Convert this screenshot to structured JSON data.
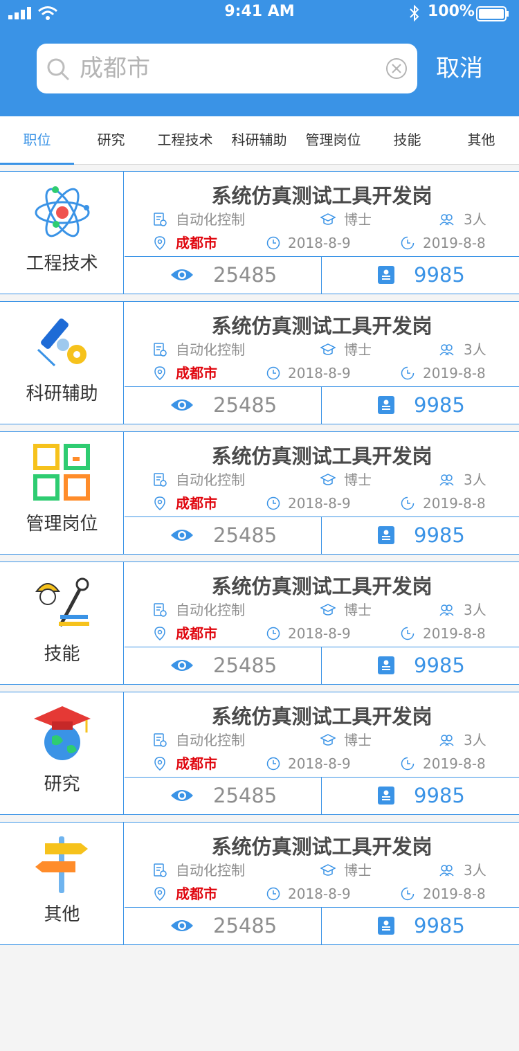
{
  "status_bar": {
    "time": "9:41 AM",
    "battery": "100%"
  },
  "search": {
    "query": "成都市",
    "cancel_label": "取消"
  },
  "tabs": [
    {
      "label": "职位",
      "active": true
    },
    {
      "label": "研究",
      "active": false
    },
    {
      "label": "工程技术",
      "active": false
    },
    {
      "label": "科研辅助",
      "active": false
    },
    {
      "label": "管理岗位",
      "active": false
    },
    {
      "label": "技能",
      "active": false
    },
    {
      "label": "其他",
      "active": false
    }
  ],
  "colors": {
    "primary": "#3a93e6",
    "location": "#e0070f"
  },
  "jobs": [
    {
      "category": "工程技术",
      "category_icon": "atom-icon",
      "title": "系统仿真测试工具开发岗",
      "specialty": "自动化控制",
      "degree": "博士",
      "headcount": "3人",
      "location": "成都市",
      "start_date": "2018-8-9",
      "end_date": "2019-8-8",
      "views": "25485",
      "applicants": "9985"
    },
    {
      "category": "科研辅助",
      "category_icon": "microscope-gear-icon",
      "title": "系统仿真测试工具开发岗",
      "specialty": "自动化控制",
      "degree": "博士",
      "headcount": "3人",
      "location": "成都市",
      "start_date": "2018-8-9",
      "end_date": "2019-8-8",
      "views": "25485",
      "applicants": "9985"
    },
    {
      "category": "管理岗位",
      "category_icon": "grid-blocks-icon",
      "title": "系统仿真测试工具开发岗",
      "specialty": "自动化控制",
      "degree": "博士",
      "headcount": "3人",
      "location": "成都市",
      "start_date": "2018-8-9",
      "end_date": "2019-8-8",
      "views": "25485",
      "applicants": "9985"
    },
    {
      "category": "技能",
      "category_icon": "worker-tools-icon",
      "title": "系统仿真测试工具开发岗",
      "specialty": "自动化控制",
      "degree": "博士",
      "headcount": "3人",
      "location": "成都市",
      "start_date": "2018-8-9",
      "end_date": "2019-8-8",
      "views": "25485",
      "applicants": "9985"
    },
    {
      "category": "研究",
      "category_icon": "graduation-globe-icon",
      "title": "系统仿真测试工具开发岗",
      "specialty": "自动化控制",
      "degree": "博士",
      "headcount": "3人",
      "location": "成都市",
      "start_date": "2018-8-9",
      "end_date": "2019-8-8",
      "views": "25485",
      "applicants": "9985"
    },
    {
      "category": "其他",
      "category_icon": "signpost-icon",
      "title": "系统仿真测试工具开发岗",
      "specialty": "自动化控制",
      "degree": "博士",
      "headcount": "3人",
      "location": "成都市",
      "start_date": "2018-8-9",
      "end_date": "2019-8-8",
      "views": "25485",
      "applicants": "9985"
    }
  ]
}
